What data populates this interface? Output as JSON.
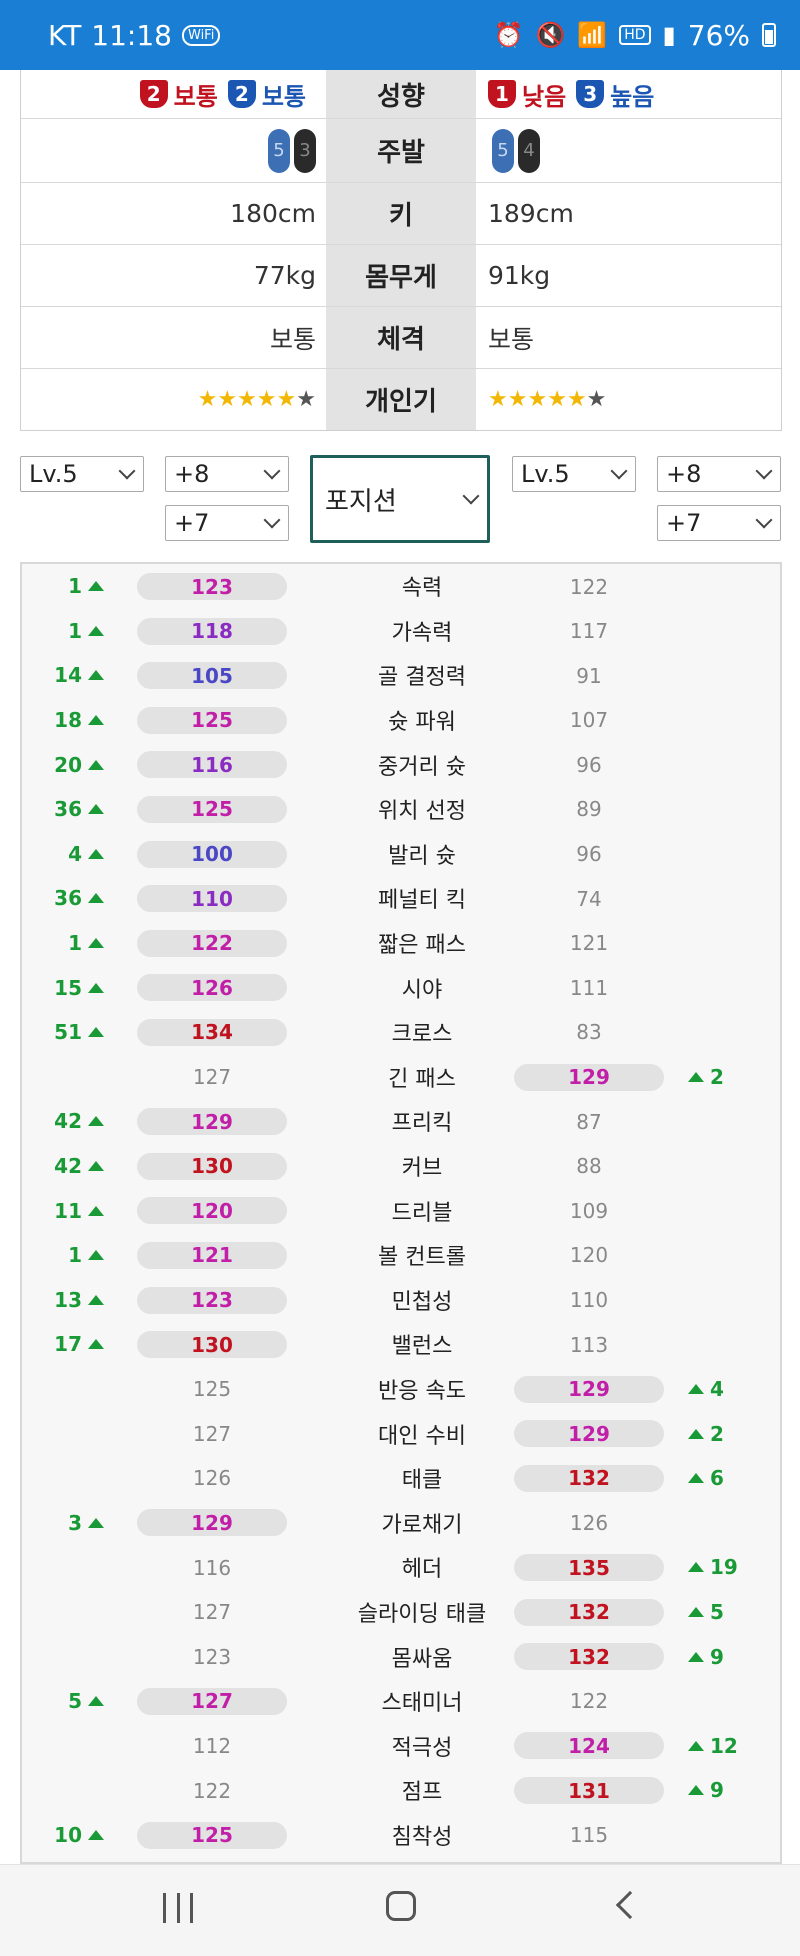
{
  "status_bar": {
    "carrier": "KT",
    "time": "11:18",
    "wifi_call": "WiFi",
    "hd": "HD",
    "battery": "76%"
  },
  "compare": {
    "tendency": {
      "label": "성향",
      "left": [
        {
          "num": "2",
          "color": "red",
          "text": "보통"
        },
        {
          "num": "2",
          "color": "blue",
          "text": "보통"
        }
      ],
      "right": [
        {
          "num": "1",
          "color": "red",
          "text": "낮음"
        },
        {
          "num": "3",
          "color": "blue",
          "text": "높음"
        }
      ]
    },
    "foot": {
      "label": "주발",
      "left": [
        "5",
        "3"
      ],
      "right": [
        "5",
        "4"
      ]
    },
    "height": {
      "label": "키",
      "left": "180cm",
      "right": "189cm"
    },
    "weight": {
      "label": "몸무게",
      "left": "77kg",
      "right": "91kg"
    },
    "build": {
      "label": "체격",
      "left": "보통",
      "right": "보통"
    },
    "skill": {
      "label": "개인기",
      "left_stars": 5,
      "right_stars": 5,
      "max_stars": 6
    }
  },
  "controls": {
    "left_level": "Lv.5",
    "left_enhance_1": "+8",
    "left_enhance_2": "+7",
    "position": "포지션",
    "right_level": "Lv.5",
    "right_enhance_1": "+8",
    "right_enhance_2": "+7"
  },
  "colors": {
    "magenta": "#c21fa8",
    "purple": "#8a2bc2",
    "blue": "#4a47c4",
    "red": "#c0121f",
    "green": "#1a9a36"
  },
  "stats": [
    {
      "name": "속력",
      "left": "123",
      "right": "122",
      "winner": "left",
      "diff": "1",
      "color": "mag"
    },
    {
      "name": "가속력",
      "left": "118",
      "right": "117",
      "winner": "left",
      "diff": "1",
      "color": "pur"
    },
    {
      "name": "골 결정력",
      "left": "105",
      "right": "91",
      "winner": "left",
      "diff": "14",
      "color": "blu"
    },
    {
      "name": "슛 파워",
      "left": "125",
      "right": "107",
      "winner": "left",
      "diff": "18",
      "color": "mag"
    },
    {
      "name": "중거리 슛",
      "left": "116",
      "right": "96",
      "winner": "left",
      "diff": "20",
      "color": "pur"
    },
    {
      "name": "위치 선정",
      "left": "125",
      "right": "89",
      "winner": "left",
      "diff": "36",
      "color": "mag"
    },
    {
      "name": "발리 슛",
      "left": "100",
      "right": "96",
      "winner": "left",
      "diff": "4",
      "color": "blu"
    },
    {
      "name": "페널티 킥",
      "left": "110",
      "right": "74",
      "winner": "left",
      "diff": "36",
      "color": "pur"
    },
    {
      "name": "짧은 패스",
      "left": "122",
      "right": "121",
      "winner": "left",
      "diff": "1",
      "color": "mag"
    },
    {
      "name": "시야",
      "left": "126",
      "right": "111",
      "winner": "left",
      "diff": "15",
      "color": "mag"
    },
    {
      "name": "크로스",
      "left": "134",
      "right": "83",
      "winner": "left",
      "diff": "51",
      "color": "red"
    },
    {
      "name": "긴 패스",
      "left": "127",
      "right": "129",
      "winner": "right",
      "diff": "2",
      "color": "mag"
    },
    {
      "name": "프리킥",
      "left": "129",
      "right": "87",
      "winner": "left",
      "diff": "42",
      "color": "mag"
    },
    {
      "name": "커브",
      "left": "130",
      "right": "88",
      "winner": "left",
      "diff": "42",
      "color": "red"
    },
    {
      "name": "드리블",
      "left": "120",
      "right": "109",
      "winner": "left",
      "diff": "11",
      "color": "mag"
    },
    {
      "name": "볼 컨트롤",
      "left": "121",
      "right": "120",
      "winner": "left",
      "diff": "1",
      "color": "mag"
    },
    {
      "name": "민첩성",
      "left": "123",
      "right": "110",
      "winner": "left",
      "diff": "13",
      "color": "mag"
    },
    {
      "name": "밸런스",
      "left": "130",
      "right": "113",
      "winner": "left",
      "diff": "17",
      "color": "red"
    },
    {
      "name": "반응 속도",
      "left": "125",
      "right": "129",
      "winner": "right",
      "diff": "4",
      "color": "mag"
    },
    {
      "name": "대인 수비",
      "left": "127",
      "right": "129",
      "winner": "right",
      "diff": "2",
      "color": "mag"
    },
    {
      "name": "태클",
      "left": "126",
      "right": "132",
      "winner": "right",
      "diff": "6",
      "color": "red"
    },
    {
      "name": "가로채기",
      "left": "129",
      "right": "126",
      "winner": "left",
      "diff": "3",
      "color": "mag"
    },
    {
      "name": "헤더",
      "left": "116",
      "right": "135",
      "winner": "right",
      "diff": "19",
      "color": "red"
    },
    {
      "name": "슬라이딩 태클",
      "left": "127",
      "right": "132",
      "winner": "right",
      "diff": "5",
      "color": "red"
    },
    {
      "name": "몸싸움",
      "left": "123",
      "right": "132",
      "winner": "right",
      "diff": "9",
      "color": "red"
    },
    {
      "name": "스태미너",
      "left": "127",
      "right": "122",
      "winner": "left",
      "diff": "5",
      "color": "mag"
    },
    {
      "name": "적극성",
      "left": "112",
      "right": "124",
      "winner": "right",
      "diff": "12",
      "color": "mag"
    },
    {
      "name": "점프",
      "left": "122",
      "right": "131",
      "winner": "right",
      "diff": "9",
      "color": "red"
    },
    {
      "name": "침착성",
      "left": "125",
      "right": "115",
      "winner": "left",
      "diff": "10",
      "color": "mag"
    }
  ]
}
